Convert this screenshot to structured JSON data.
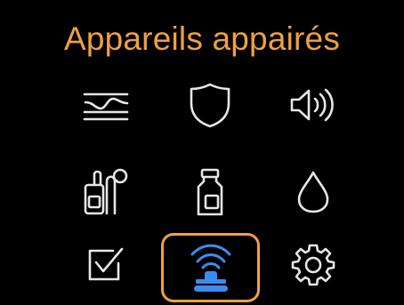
{
  "header": {
    "title": "Appareils appairés"
  },
  "colors": {
    "accent": "#f0a040",
    "icon": "#e6e6e6",
    "selected_icon": "#3c8cf0",
    "background": "#000000"
  },
  "menu": {
    "items": [
      {
        "name": "graph-icon",
        "selected": false
      },
      {
        "name": "shield-icon",
        "selected": false
      },
      {
        "name": "speaker-icon",
        "selected": false
      },
      {
        "name": "pump-cgm-icon",
        "selected": false
      },
      {
        "name": "insulin-vial-icon",
        "selected": false
      },
      {
        "name": "drop-icon",
        "selected": false
      },
      {
        "name": "checkbox-icon",
        "selected": false
      },
      {
        "name": "paired-device-icon",
        "selected": true
      },
      {
        "name": "gear-icon",
        "selected": false
      }
    ]
  }
}
